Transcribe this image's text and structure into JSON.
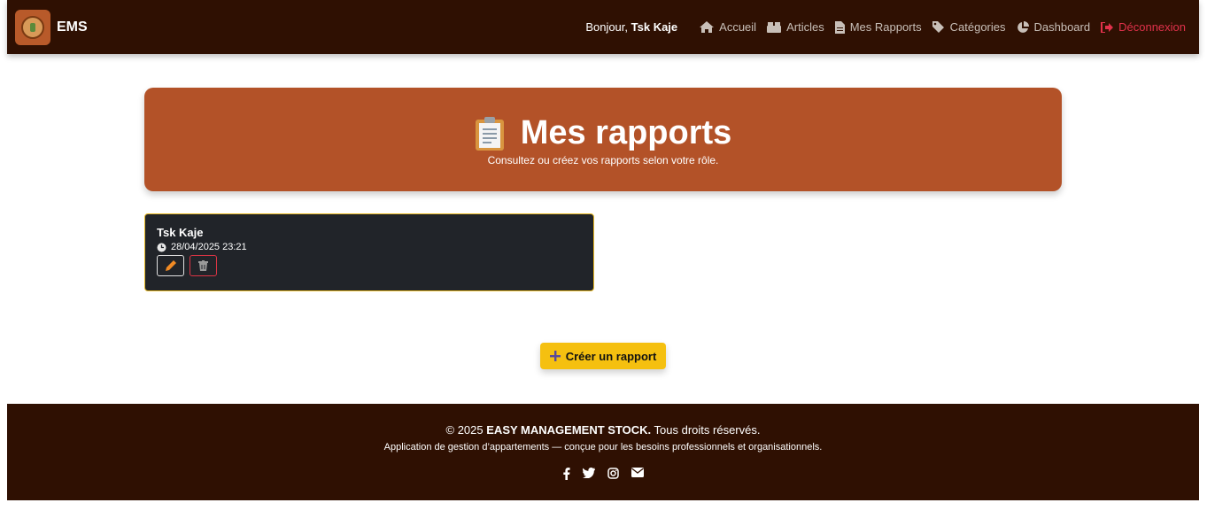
{
  "app": {
    "brand": "EMS"
  },
  "nav": {
    "greeting_prefix": "Bonjour,",
    "user_name": "Tsk Kaje",
    "links": [
      {
        "label": "Accueil",
        "icon": "home-icon"
      },
      {
        "label": "Articles",
        "icon": "boxes-icon"
      },
      {
        "label": "Mes Rapports",
        "icon": "file-icon"
      },
      {
        "label": "Catégories",
        "icon": "tags-icon"
      },
      {
        "label": "Dashboard",
        "icon": "chart-pie-icon"
      }
    ],
    "logout": {
      "label": "Déconnexion",
      "icon": "sign-out-icon"
    }
  },
  "hero": {
    "icon": "clipboard-icon",
    "title": "Mes rapports",
    "subtitle": "Consultez ou créez vos rapports selon votre rôle."
  },
  "reports": [
    {
      "author": "Tsk Kaje",
      "datetime": "28/04/2025 23:21"
    }
  ],
  "actions": {
    "create_label": "Créer un rapport"
  },
  "footer": {
    "copyright_prefix": "© 2025",
    "company": "EASY MANAGEMENT STOCK.",
    "rights": "Tous droits réservés.",
    "tagline": "Application de gestion d’appartements — conçue pour les besoins professionnels et organisationnels.",
    "socials": [
      "facebook-icon",
      "twitter-icon",
      "instagram-icon",
      "envelope-icon"
    ]
  },
  "colors": {
    "navbar": "#2f1002",
    "hero": "#b35228",
    "card": "#212429",
    "card_border": "#e8b923",
    "cta": "#f5c010",
    "logout": "#e0314b"
  }
}
